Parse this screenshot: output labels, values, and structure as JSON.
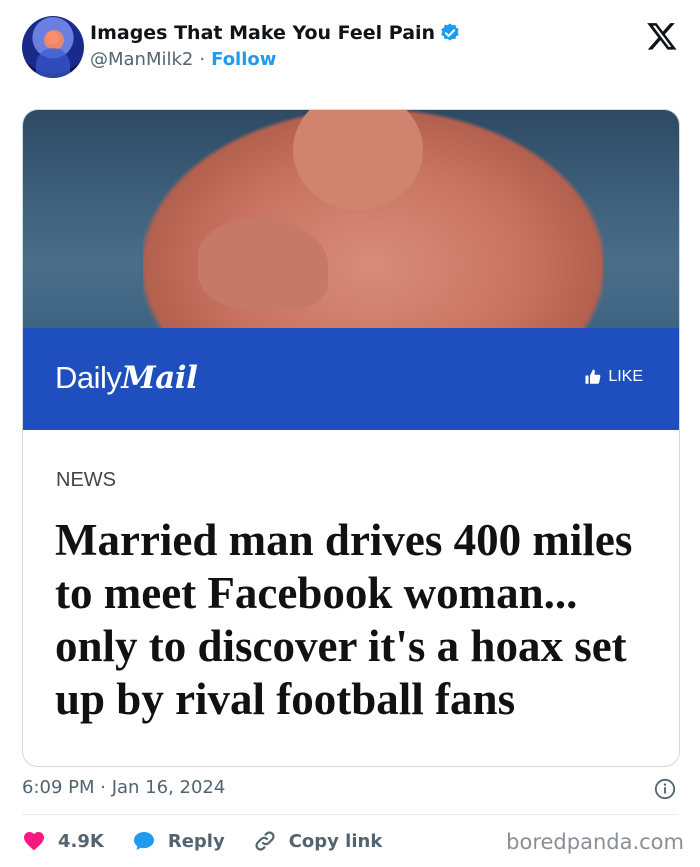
{
  "account": {
    "display_name": "Images That Make You Feel Pain",
    "handle": "@ManMilk2",
    "separator": "·",
    "follow_label": "Follow"
  },
  "media": {
    "publication_prefix": "Daily",
    "publication_name": "Mail",
    "like_label": "LIKE",
    "section": "NEWS",
    "headline": "Married man drives 400 miles to meet Facebook woman... only to discover it's a hoax set up by rival football fans"
  },
  "tweet": {
    "timestamp": "6:09 PM · Jan 16, 2024"
  },
  "actions": {
    "likes": "4.9K",
    "reply": "Reply",
    "copy_link": "Copy link"
  },
  "watermark": "boredpanda.com",
  "colors": {
    "accent": "#1d9bf0",
    "like_heart": "#f91880",
    "daily_mail_banner": "#1f4fbf"
  },
  "icons": [
    "verified-badge-icon",
    "x-logo-icon",
    "thumbs-up-icon",
    "info-icon",
    "heart-icon",
    "reply-bubble-icon",
    "link-icon"
  ]
}
